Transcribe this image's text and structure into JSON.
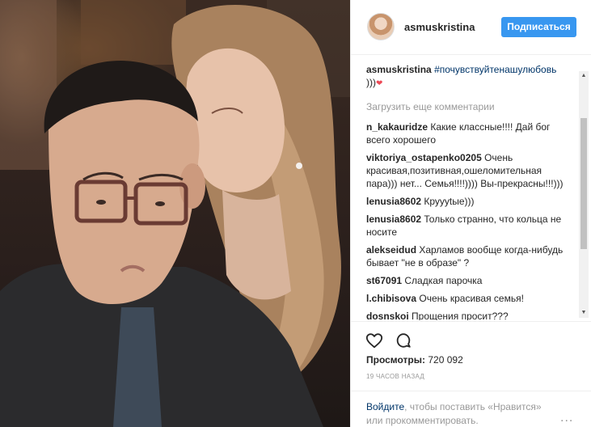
{
  "post": {
    "author": "asmuskristina",
    "follow_label": "Подписаться",
    "caption": {
      "username": "asmuskristina",
      "hashtag": "#почувствуйтенашулюбовь",
      "text": ")))",
      "emoji": "❤"
    },
    "load_more_label": "Загрузить еще комментарии",
    "comments": [
      {
        "username": "n_kakauridze",
        "text": "Какие классные!!!! Дай бог всего хорошего"
      },
      {
        "username": "viktoriya_ostapenko0205",
        "text": "Очень красивая,позитивная,ошеломительная пара))) нет... Семья!!!!)))) Вы-прекрасны!!!)))"
      },
      {
        "username": "lenusia8602",
        "text": "Круууtые)))"
      },
      {
        "username": "lenusia8602",
        "text": "Только странно, что кольца не носите"
      },
      {
        "username": "alekseidud",
        "text": "Харламов вообще когда-нибудь бывает \"не в образе\" ?"
      },
      {
        "username": "st67091",
        "text": "Сладкая парочка"
      },
      {
        "username": "l.chibisova",
        "text": "Очень красивая семья!"
      },
      {
        "username": "dosnskoi",
        "text": "Прощения просит???"
      }
    ],
    "views_label": "Просмотры:",
    "views_count": "720 092",
    "time_ago": "19 ЧАСОВ НАЗАД",
    "login_prompt": {
      "link": "Войдите",
      "text": ", чтобы поставить «Нравится» или прокомментировать."
    },
    "more_label": "..."
  },
  "icons": {
    "like": "heart-outline-icon",
    "comment": "comment-bubble-icon",
    "more": "more-dots-icon"
  },
  "colors": {
    "accent": "#3897f0",
    "link": "#003569",
    "muted": "#999999",
    "heart": "#ed4956"
  }
}
